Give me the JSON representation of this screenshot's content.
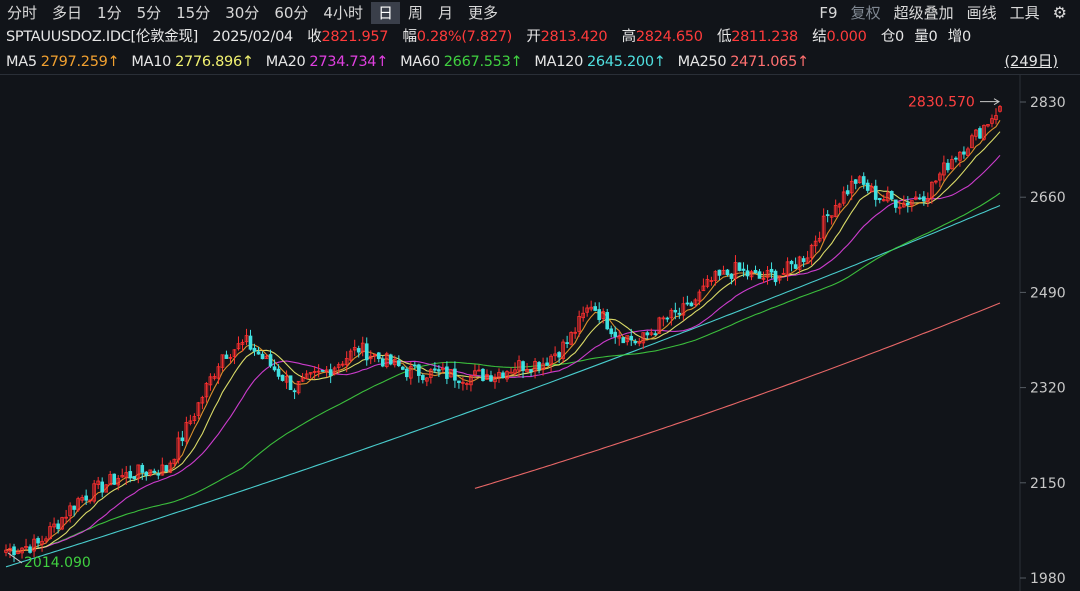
{
  "toolbar": {
    "periods": [
      "分时",
      "多日",
      "1分",
      "5分",
      "15分",
      "30分",
      "60分",
      "4小时",
      "日",
      "周",
      "月",
      "更多"
    ],
    "active": "日",
    "right": [
      "F9",
      "复权",
      "超级叠加",
      "画线",
      "工具"
    ],
    "settings_icon": "settings-gear-icon"
  },
  "info": {
    "symbol": "SPTAUUSDOZ.IDC[伦敦金现]",
    "date": "2025/02/04",
    "close_label": "收",
    "close": "2821.957",
    "change_label": "幅",
    "change": "0.28%(7.827)",
    "open_label": "开",
    "open": "2813.420",
    "high_label": "高",
    "high": "2824.650",
    "low_label": "低",
    "low": "2811.238",
    "settle_label": "结",
    "settle": "0.000",
    "oi_label": "仓",
    "oi": "0",
    "vol_label": "量",
    "vol": "0",
    "inc_label": "增",
    "inc": "0"
  },
  "ma_legend": [
    {
      "label": "MA5",
      "value": "2797.259↑",
      "color": "#f0a030"
    },
    {
      "label": "MA10",
      "value": "2776.896↑",
      "color": "#f0f070"
    },
    {
      "label": "MA20",
      "value": "2734.734↑",
      "color": "#e040e0"
    },
    {
      "label": "MA60",
      "value": "2667.553↑",
      "color": "#40d040"
    },
    {
      "label": "MA120",
      "value": "2645.200↑",
      "color": "#50e0e0"
    },
    {
      "label": "MA250",
      "value": "2471.065↑",
      "color": "#ff7070"
    }
  ],
  "days_label": "(249日)",
  "colors": {
    "up": "#ff3030",
    "down": "#40e0e0",
    "background": "#111419"
  },
  "chart_data": {
    "type": "candlestick",
    "y_axis_ticks": [
      "2830",
      "2660",
      "2490",
      "2320",
      "2150",
      "1980"
    ],
    "ylim": [
      1980,
      2830
    ],
    "period": "日",
    "bars": 249,
    "annotations": {
      "high": "2830.570",
      "low": "2014.090"
    },
    "anchors_close": [
      [
        0,
        2030
      ],
      [
        8,
        2040
      ],
      [
        18,
        2120
      ],
      [
        28,
        2160
      ],
      [
        34,
        2170
      ],
      [
        40,
        2175
      ],
      [
        48,
        2290
      ],
      [
        54,
        2380
      ],
      [
        60,
        2400
      ],
      [
        66,
        2360
      ],
      [
        72,
        2320
      ],
      [
        80,
        2350
      ],
      [
        88,
        2390
      ],
      [
        94,
        2370
      ],
      [
        100,
        2350
      ],
      [
        108,
        2345
      ],
      [
        116,
        2340
      ],
      [
        122,
        2345
      ],
      [
        128,
        2360
      ],
      [
        134,
        2365
      ],
      [
        140,
        2400
      ],
      [
        146,
        2470
      ],
      [
        152,
        2420
      ],
      [
        158,
        2400
      ],
      [
        164,
        2440
      ],
      [
        170,
        2460
      ],
      [
        176,
        2510
      ],
      [
        182,
        2530
      ],
      [
        188,
        2515
      ],
      [
        194,
        2525
      ],
      [
        200,
        2560
      ],
      [
        206,
        2640
      ],
      [
        212,
        2690
      ],
      [
        218,
        2660
      ],
      [
        224,
        2650
      ],
      [
        230,
        2670
      ],
      [
        236,
        2730
      ],
      [
        242,
        2770
      ],
      [
        248,
        2821.957
      ]
    ],
    "moving_averages": [
      {
        "name": "MA5",
        "value": 2797.259
      },
      {
        "name": "MA10",
        "value": 2776.896
      },
      {
        "name": "MA20",
        "value": 2734.734
      },
      {
        "name": "MA60",
        "value": 2667.553
      },
      {
        "name": "MA120",
        "value": 2645.2
      },
      {
        "name": "MA250",
        "value": 2471.065
      }
    ]
  }
}
